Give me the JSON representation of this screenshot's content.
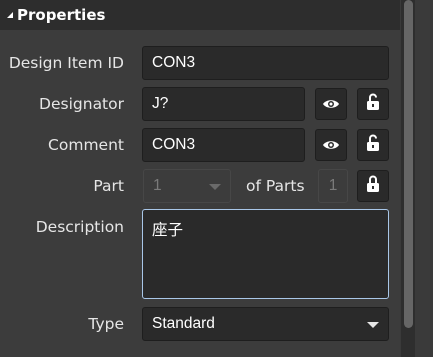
{
  "section": {
    "title": "Properties",
    "collapse_icon": "triangle-down-right-icon"
  },
  "fields": {
    "design_item_id": {
      "label": "Design Item ID",
      "value": "CON3"
    },
    "designator": {
      "label": "Designator",
      "value": "J?"
    },
    "comment": {
      "label": "Comment",
      "value": "CON3"
    },
    "part": {
      "label": "Part",
      "value": "1",
      "of_parts_label": "of Parts",
      "parts_count": "1"
    },
    "description": {
      "label": "Description",
      "value": "座子"
    },
    "type": {
      "label": "Type",
      "value": "Standard"
    }
  },
  "icons": {
    "visibility": "eye-icon",
    "lock_open": "unlocked-icon",
    "lock_closed": "locked-icon"
  },
  "colors": {
    "panel_bg": "#3c3c3c",
    "field_bg": "#2a2a2a",
    "focus_border": "#a9c7e8"
  }
}
